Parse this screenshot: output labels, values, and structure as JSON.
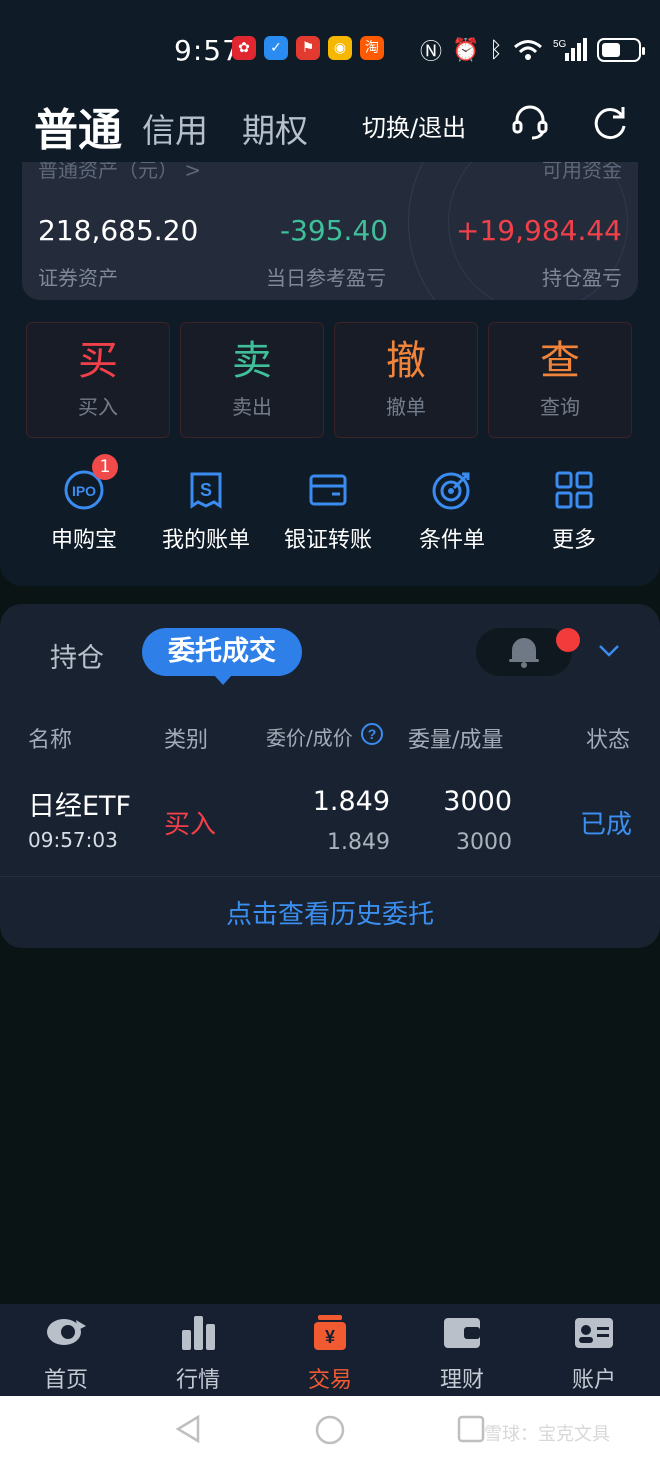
{
  "status_bar": {
    "time": "9:57",
    "app_icons": [
      "huawei",
      "app-blue",
      "app-red",
      "weibo",
      "taobao"
    ],
    "taobao_label": "淘",
    "network": "5G"
  },
  "header": {
    "tabs": [
      "普通",
      "信用",
      "期权"
    ],
    "switch_label": "切换/退出"
  },
  "assets": {
    "faded_left": "普通资产（元） >",
    "faded_right": "可用资金",
    "total_value": "218,685.20",
    "total_label": "证券资产",
    "day_pl_value": "-395.40",
    "day_pl_label": "当日参考盈亏",
    "hold_pl_value": "+19,984.44",
    "hold_pl_label": "持仓盈亏",
    "colors": {
      "gain": "#f2404a",
      "loss": "#3fbf9a"
    }
  },
  "actions": [
    {
      "big": "买",
      "small": "买入",
      "color": "#f2404a"
    },
    {
      "big": "卖",
      "small": "卖出",
      "color": "#3fbf9a"
    },
    {
      "big": "撤",
      "small": "撤单",
      "color": "#f0843a"
    },
    {
      "big": "查",
      "small": "查询",
      "color": "#f0843a"
    }
  ],
  "quick": [
    {
      "icon": "ipo-icon",
      "label": "申购宝",
      "badge": "1",
      "ipo_text": "IPO"
    },
    {
      "icon": "bill-icon",
      "label": "我的账单"
    },
    {
      "icon": "wallet-icon",
      "label": "银证转账"
    },
    {
      "icon": "target-icon",
      "label": "条件单"
    },
    {
      "icon": "grid-icon",
      "label": "更多"
    }
  ],
  "orders": {
    "tab_holdings": "持仓",
    "tab_orders": "委托成交",
    "headers": {
      "name": "名称",
      "type": "类别",
      "price": "委价/成价",
      "qty": "委量/成量",
      "status": "状态"
    },
    "row": {
      "name": "日经ETF",
      "time": "09:57:03",
      "type": "买入",
      "order_price": "1.849",
      "deal_price": "1.849",
      "order_qty": "3000",
      "deal_qty": "3000",
      "status": "已成"
    },
    "history_link": "点击查看历史委托"
  },
  "bottom_nav": [
    {
      "label": "首页",
      "icon": "home-icon"
    },
    {
      "label": "行情",
      "icon": "market-icon"
    },
    {
      "label": "交易",
      "icon": "trade-icon",
      "active": true
    },
    {
      "label": "理财",
      "icon": "finance-icon"
    },
    {
      "label": "账户",
      "icon": "account-icon"
    }
  ],
  "watermark": "雪球：宝克文具"
}
